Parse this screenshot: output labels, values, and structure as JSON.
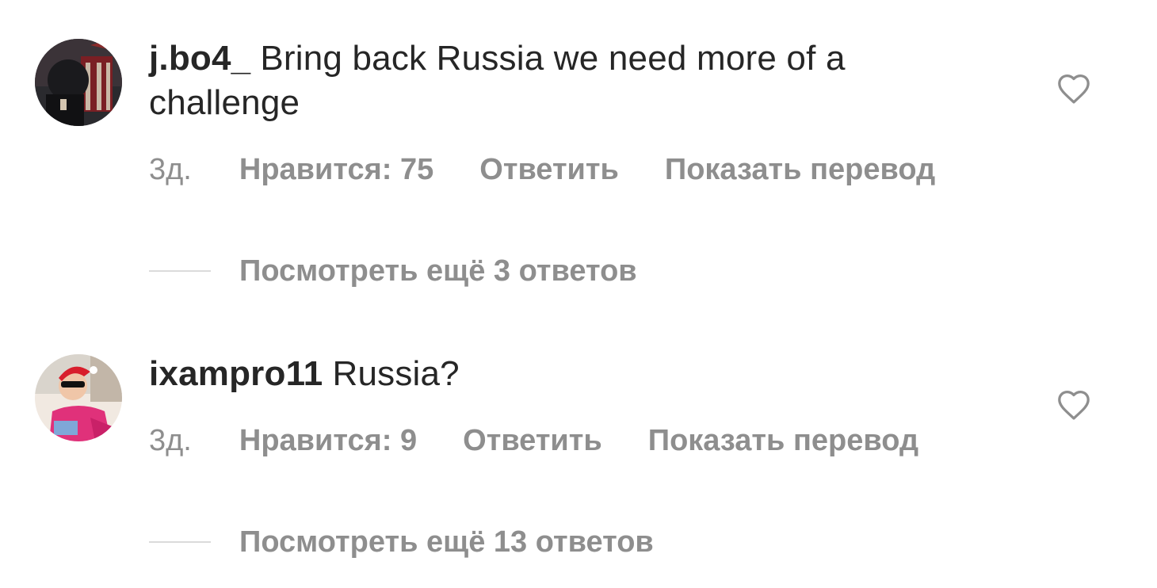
{
  "comments": [
    {
      "username": "j.bo4_",
      "text": "Bring back Russia we need more of a challenge",
      "time": "3д.",
      "likes": "Нравится: 75",
      "reply": "Ответить",
      "translate": "Показать перевод",
      "view_replies": "Посмотреть ещё 3 ответов"
    },
    {
      "username": "ixampro11",
      "text": "Russia?",
      "time": "3д.",
      "likes": "Нравится: 9",
      "reply": "Ответить",
      "translate": "Показать перевод",
      "view_replies": "Посмотреть ещё 13 ответов"
    }
  ],
  "colors": {
    "text": "#262626",
    "muted": "#8e8e8e",
    "divider": "#dbdbdb"
  }
}
